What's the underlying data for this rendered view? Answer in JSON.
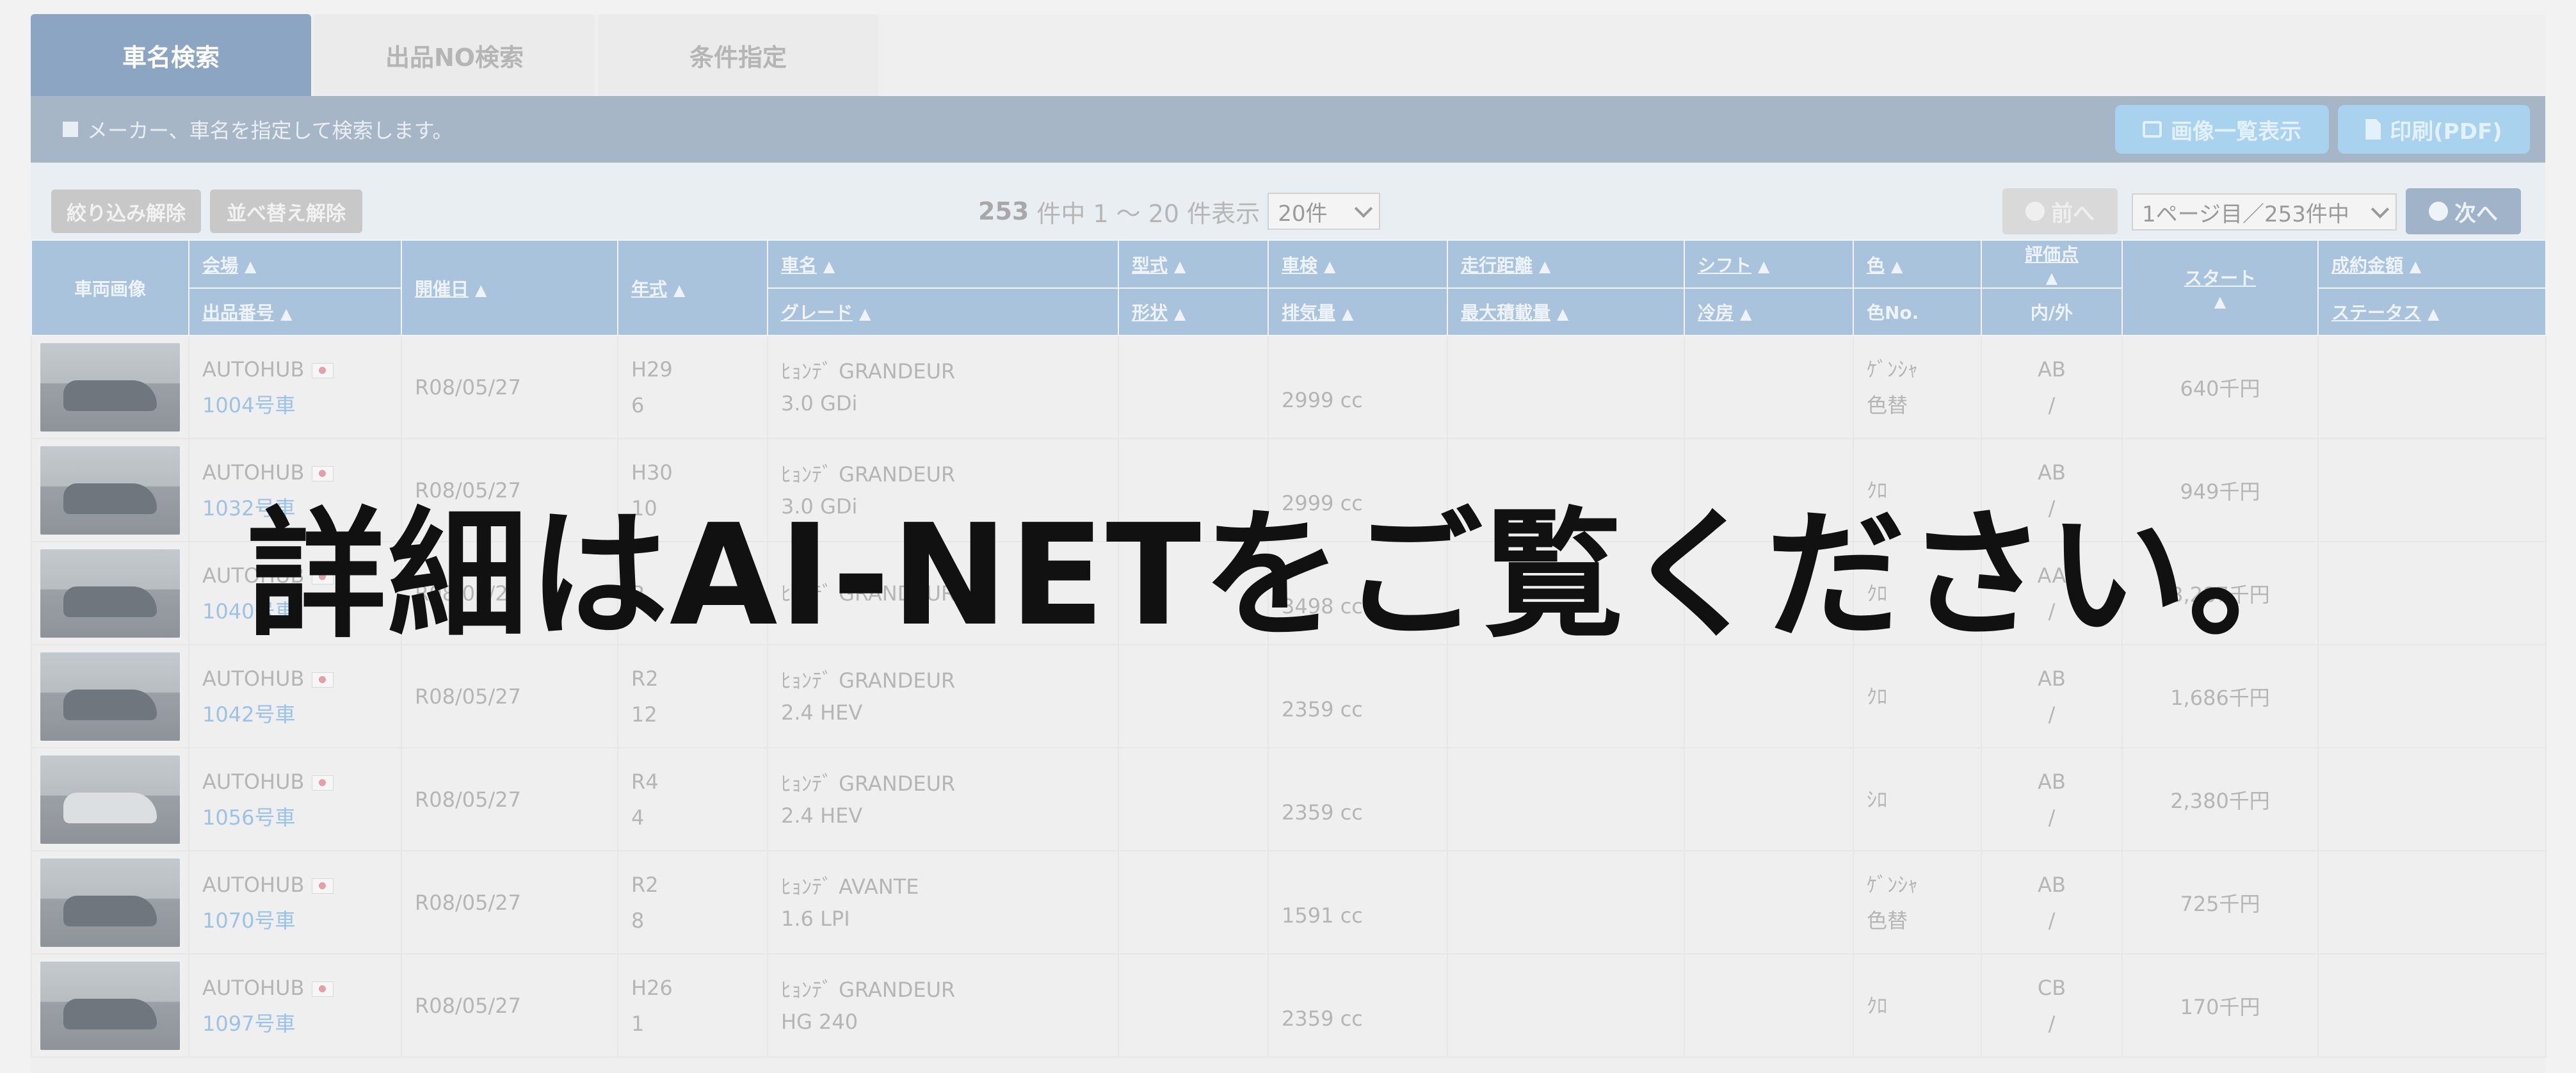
{
  "tabs": [
    {
      "label": "車名検索",
      "active": true
    },
    {
      "label": "出品NO検索",
      "active": false
    },
    {
      "label": "条件指定",
      "active": false
    }
  ],
  "info": {
    "message": "メーカー、車名を指定して検索します。",
    "image_list_button": "画像一覧表示",
    "print_button": "印刷(PDF)"
  },
  "controls": {
    "clear_filter": "絞り込み解除",
    "clear_sort": "並べ替え解除",
    "total": "253",
    "range_text": "件中 1 〜 20 件表示",
    "per_page": "20件",
    "prev": "前へ",
    "page_select": "1ページ目／253件中",
    "next": "次へ"
  },
  "table": {
    "headers": {
      "image": "車両画像",
      "venue": "会場",
      "lot": "出品番号",
      "date": "開催日",
      "year": "年式",
      "name": "車名",
      "grade": "グレード",
      "model": "型式",
      "shape": "形状",
      "inspection": "車検",
      "displacement": "排気量",
      "mileage": "走行距離",
      "max_load": "最大積載量",
      "shift": "シフト",
      "ac": "冷房",
      "color": "色",
      "color_no": "色No.",
      "score": "評価点",
      "inout": "内/外",
      "start": "スタート",
      "sold": "成約金額",
      "status": "ステータス",
      "sort_mark": "▲"
    },
    "rows": [
      {
        "venue": "AUTOHUB",
        "lot": "1004号車",
        "date": "R08/05/27",
        "year": "H29",
        "month": "6",
        "name": "ﾋｮﾝﾃﾞ GRANDEUR",
        "grade": "3.0 GDi",
        "disp": "2999 cc",
        "color": "ｹﾞﾝｼｬ",
        "color2": "色替",
        "score": "AB",
        "inout": "/",
        "start": "640千円"
      },
      {
        "venue": "AUTOHUB",
        "lot": "1032号車",
        "date": "R08/05/27",
        "year": "H30",
        "month": "10",
        "name": "ﾋｮﾝﾃﾞ GRANDEUR",
        "grade": "3.0 GDi",
        "disp": "2999 cc",
        "color": "ｸﾛ",
        "color2": "",
        "score": "AB",
        "inout": "/",
        "start": "949千円"
      },
      {
        "venue": "AUTOHUB",
        "lot": "1040号車",
        "date": "R08/05/27",
        "year": "R",
        "month": "",
        "name": "ﾋｮﾝﾃﾞ GRANDEUR",
        "grade": "",
        "disp": "3498 cc",
        "color": "ｸﾛ",
        "color2": "",
        "score": "AA",
        "inout": "/",
        "start": "3,287千円"
      },
      {
        "venue": "AUTOHUB",
        "lot": "1042号車",
        "date": "R08/05/27",
        "year": "R2",
        "month": "12",
        "name": "ﾋｮﾝﾃﾞ GRANDEUR",
        "grade": "2.4 HEV",
        "disp": "2359 cc",
        "color": "ｸﾛ",
        "color2": "",
        "score": "AB",
        "inout": "/",
        "start": "1,686千円"
      },
      {
        "venue": "AUTOHUB",
        "lot": "1056号車",
        "date": "R08/05/27",
        "year": "R4",
        "month": "4",
        "name": "ﾋｮﾝﾃﾞ GRANDEUR",
        "grade": "2.4 HEV",
        "disp": "2359 cc",
        "color": "ｼﾛ",
        "color2": "",
        "score": "AB",
        "inout": "/",
        "start": "2,380千円"
      },
      {
        "venue": "AUTOHUB",
        "lot": "1070号車",
        "date": "R08/05/27",
        "year": "R2",
        "month": "8",
        "name": "ﾋｮﾝﾃﾞ AVANTE",
        "grade": "1.6 LPI",
        "disp": "1591 cc",
        "color": "ｹﾞﾝｼｬ",
        "color2": "色替",
        "score": "AB",
        "inout": "/",
        "start": "725千円"
      },
      {
        "venue": "AUTOHUB",
        "lot": "1097号車",
        "date": "R08/05/27",
        "year": "H26",
        "month": "1",
        "name": "ﾋｮﾝﾃﾞ GRANDEUR",
        "grade": "HG 240",
        "disp": "2359 cc",
        "color": "ｸﾛ",
        "color2": "",
        "score": "CB",
        "inout": "/",
        "start": "170千円"
      }
    ]
  },
  "overlay": {
    "text": "詳細はAI-NETをご覧ください。"
  }
}
